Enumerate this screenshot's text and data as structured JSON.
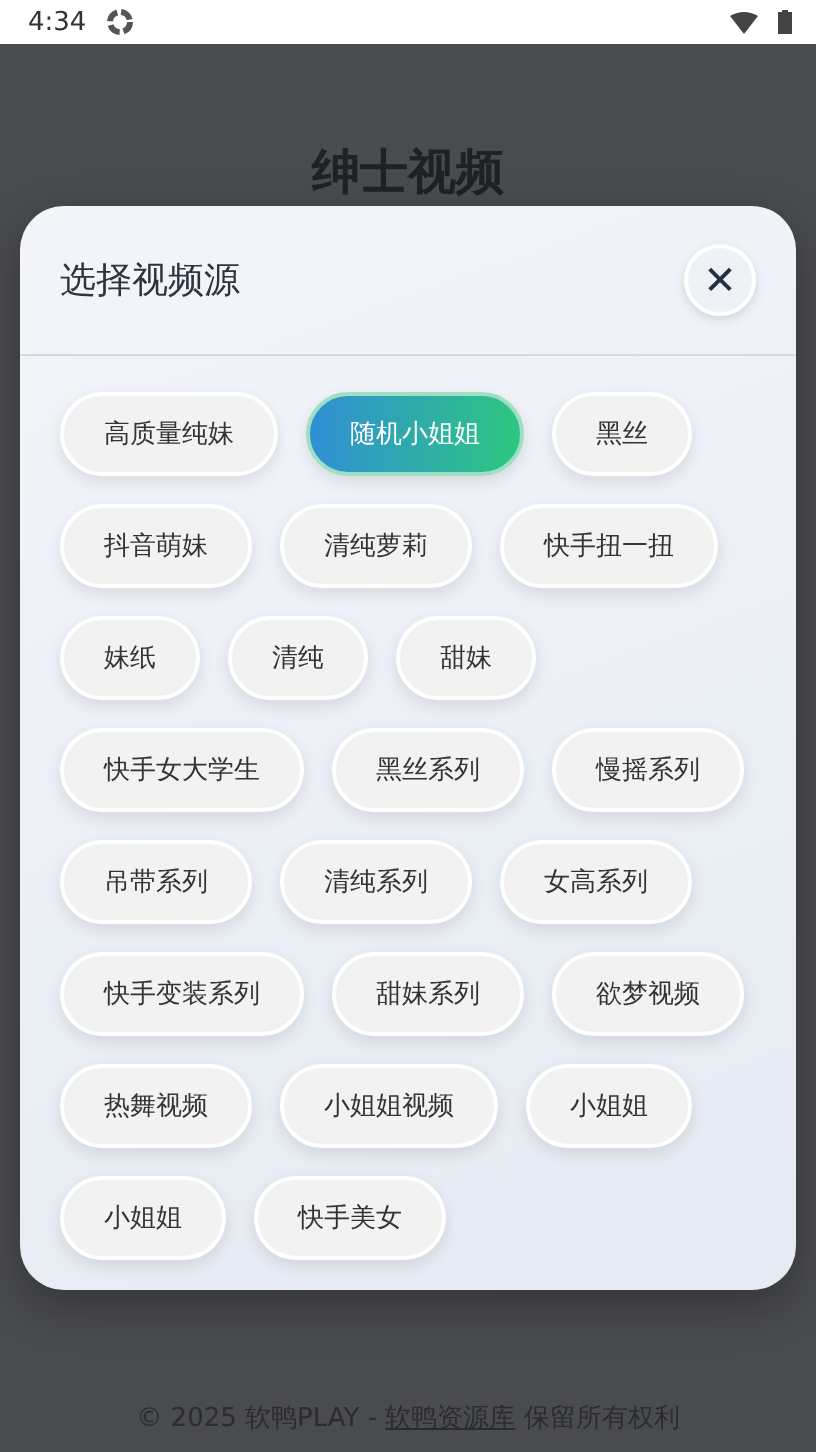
{
  "status_bar": {
    "time": "4:34"
  },
  "page": {
    "title": "绅士视频"
  },
  "dialog": {
    "title": "选择视频源",
    "close": "✕",
    "sources": [
      {
        "label": "高质量纯妹",
        "selected": false
      },
      {
        "label": "随机小姐姐",
        "selected": true
      },
      {
        "label": "黑丝",
        "selected": false
      },
      {
        "label": "抖音萌妹",
        "selected": false
      },
      {
        "label": "清纯萝莉",
        "selected": false
      },
      {
        "label": "快手扭一扭",
        "selected": false
      },
      {
        "label": "妹纸",
        "selected": false
      },
      {
        "label": "清纯",
        "selected": false
      },
      {
        "label": "甜妹",
        "selected": false
      },
      {
        "label": "快手女大学生",
        "selected": false
      },
      {
        "label": "黑丝系列",
        "selected": false
      },
      {
        "label": "慢摇系列",
        "selected": false
      },
      {
        "label": "吊带系列",
        "selected": false
      },
      {
        "label": "清纯系列",
        "selected": false
      },
      {
        "label": "女高系列",
        "selected": false
      },
      {
        "label": "快手变装系列",
        "selected": false
      },
      {
        "label": "甜妹系列",
        "selected": false
      },
      {
        "label": "欲梦视频",
        "selected": false
      },
      {
        "label": "热舞视频",
        "selected": false
      },
      {
        "label": "小姐姐视频",
        "selected": false
      },
      {
        "label": "小姐姐",
        "selected": false
      },
      {
        "label": "小姐姐",
        "selected": false
      },
      {
        "label": "快手美女",
        "selected": false
      }
    ]
  },
  "footer": {
    "before": "© 2025 软鸭PLAY - ",
    "link": "软鸭资源库",
    "after": " 保留所有权利"
  }
}
